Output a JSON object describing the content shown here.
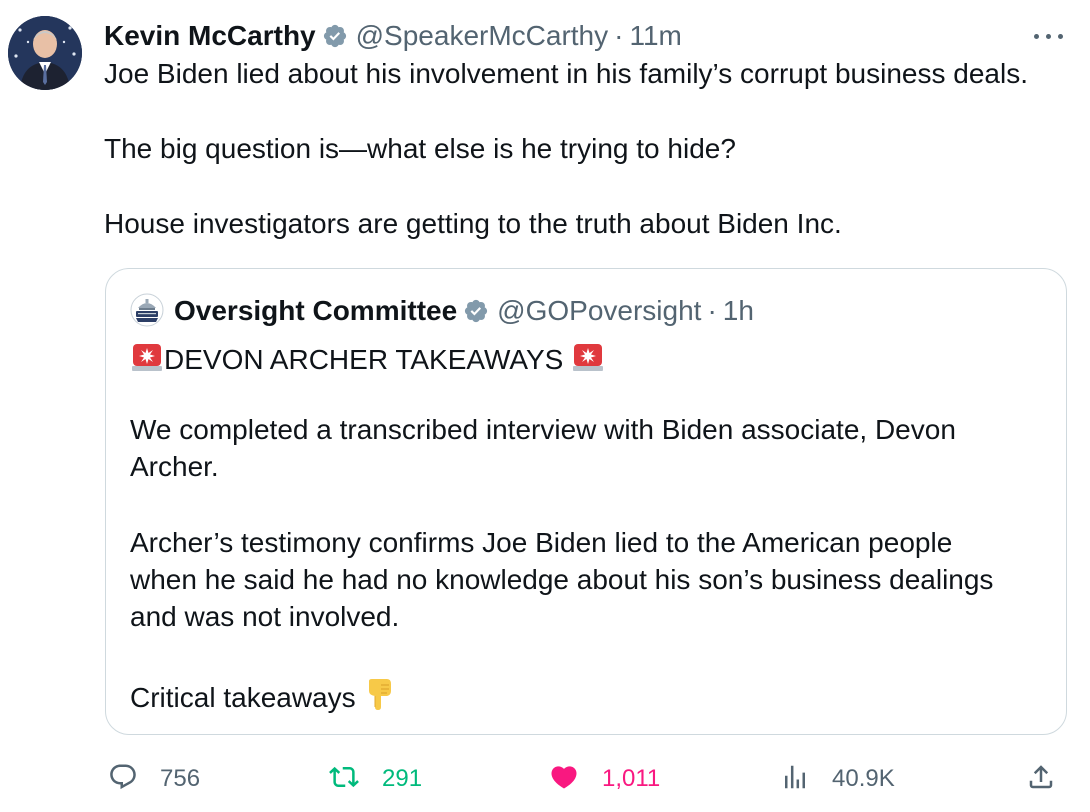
{
  "tweet": {
    "author_name": "Kevin McCarthy",
    "author_handle": "@SpeakerMcCarthy",
    "separator": "·",
    "time": "11m",
    "text_lines": [
      "Joe Biden lied about his involvement in his family’s corrupt business deals.",
      "The big question is—what else is he trying to hide?",
      "House investigators are getting to the truth about Biden Inc."
    ]
  },
  "quoted": {
    "author_name": "Oversight Committee",
    "author_handle": "@GOPoversight",
    "separator": "·",
    "time": "1h",
    "title": "DEVON ARCHER TAKEAWAYS",
    "text_lines": [
      "We completed a transcribed interview with Biden associate, Devon",
      "Archer.",
      "Archer’s testimony confirms Joe Biden lied to the American people",
      "when he said he had no knowledge about his son’s business dealings",
      "and was not involved.",
      "Critical takeaways"
    ]
  },
  "actions": {
    "replies": "756",
    "retweets": "291",
    "likes": "1,011",
    "views": "40.9K"
  },
  "colors": {
    "text": "#0f1419",
    "secondary": "#536471",
    "border": "#cfd9de",
    "verified": "#829aab",
    "retweet": "#00ba7c",
    "like": "#f91880"
  },
  "icons": [
    "verified-icon",
    "more-icon",
    "siren-emoji",
    "pointing-down-emoji",
    "reply-icon",
    "retweet-icon",
    "like-icon",
    "views-icon",
    "share-icon"
  ]
}
